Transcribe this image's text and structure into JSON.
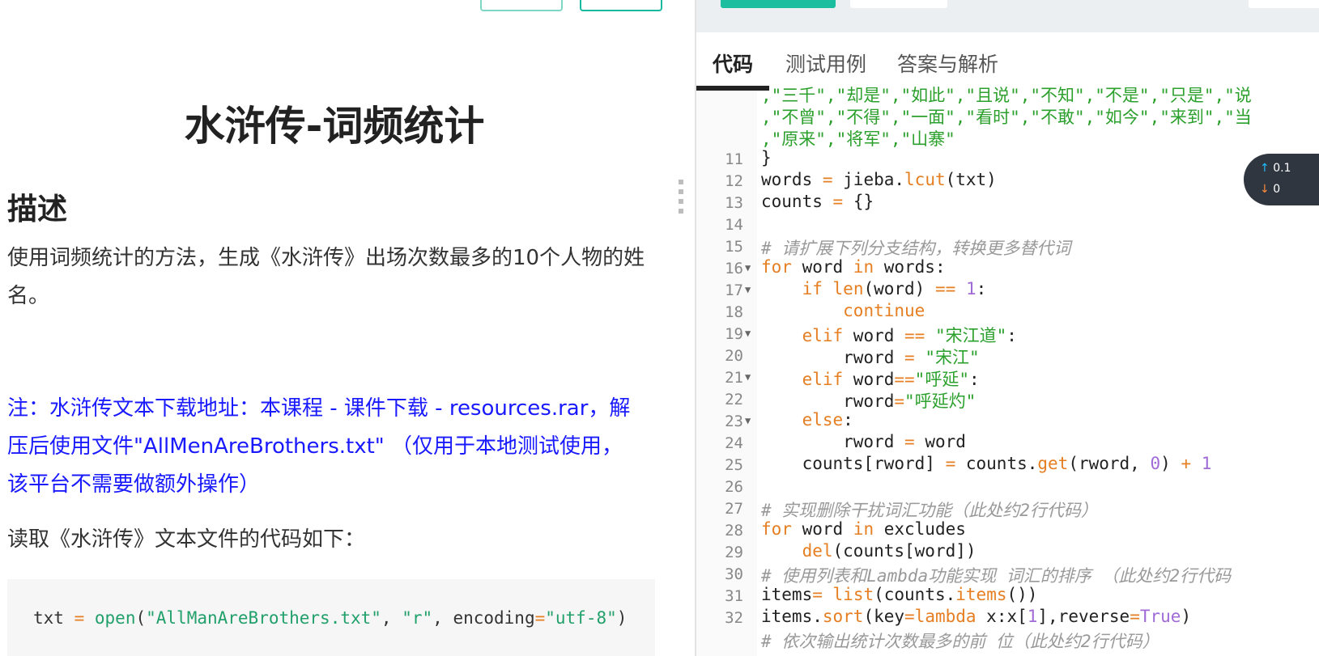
{
  "left": {
    "title": "水浒传-词频统计",
    "desc_heading": "描述",
    "desc_text": "使用词频统计的方法，生成《水浒传》出场次数最多的10个人物的姓名。",
    "note": "注：水浒传文本下载地址：本课程 - 课件下载 - resources.rar，解压后使用文件\"AllMenAreBrothers.txt\" （仅用于本地测试使用，该平台不需要做额外操作）",
    "read_text": "读取《水浒传》文本文件的代码如下：",
    "code_line": "txt = open(\"AllManAreBrothers.txt\", \"r\", encoding=\"utf-8\")"
  },
  "tabs": [
    "代码",
    "测试用例",
    "答案与解析"
  ],
  "float": {
    "up": "0.1",
    "down": "0"
  }
}
